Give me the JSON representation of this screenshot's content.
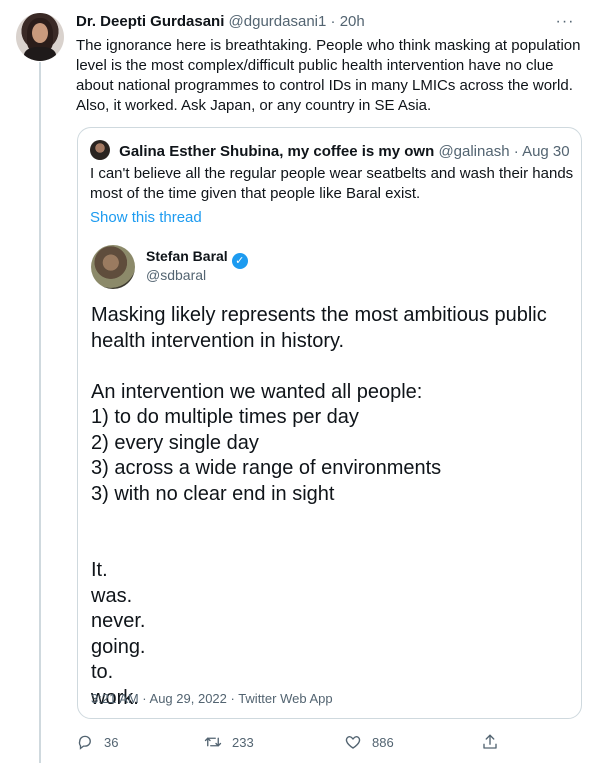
{
  "tweet": {
    "author_name": "Dr. Deepti Gurdasani",
    "author_handle": "@dgurdasani1",
    "time": "20h",
    "text": "The ignorance here is breathtaking. People who think masking at population level is the most complex/difficult public health intervention have no clue about national programmes to control IDs in many LMICs across the world. Also, it worked. Ask Japan, or any country in SE Asia."
  },
  "quote": {
    "author_name": "Galina Esther Shubina, my coffee is my own",
    "author_handle": "@galinash",
    "date": "Aug 30",
    "text": "I can't believe all the regular people wear seatbelts and wash their hands most of the time given that people like Baral exist.",
    "show_thread": "Show this thread",
    "embed": {
      "name": "Stefan Baral",
      "handle": "@sdbaral",
      "lines": [
        "Masking likely represents the most ambitious public",
        "health intervention in history.",
        "",
        "An intervention we wanted all people:",
        "1) to do multiple times per day",
        "2) every single day",
        "3) across a wide range of environments",
        "3) with no clear end in sight",
        "",
        "",
        "It.",
        "was.",
        "never.",
        "going.",
        "to.",
        "work."
      ],
      "footer": "3:21 AM · Aug 29, 2022 · Twitter Web App"
    }
  },
  "actions": {
    "reply_count": "36",
    "retweet_count": "233",
    "like_count": "886"
  },
  "icons": {
    "more": "more-icon",
    "reply": "reply-icon",
    "retweet": "retweet-icon",
    "like": "like-icon",
    "share": "share-icon",
    "verified": "verified-badge-icon"
  },
  "colors": {
    "link": "#1d9bf0",
    "secondary_text": "#536471",
    "border": "#cfd9de"
  }
}
